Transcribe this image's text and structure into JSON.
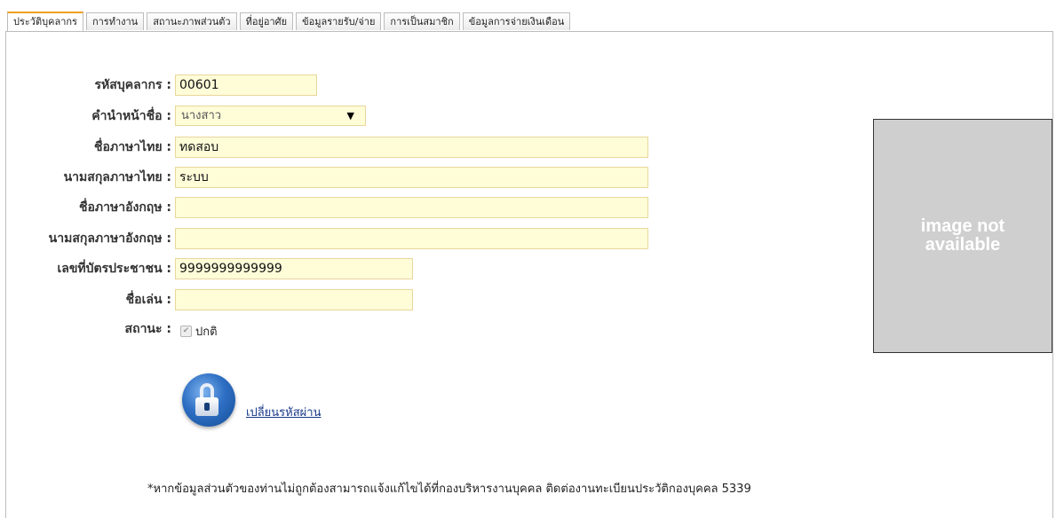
{
  "tabs": [
    {
      "label": "ประวัติบุคลากร",
      "active": true
    },
    {
      "label": "การทำงาน",
      "active": false
    },
    {
      "label": "สถานะภาพส่วนตัว",
      "active": false
    },
    {
      "label": "ที่อยู่อาศัย",
      "active": false
    },
    {
      "label": "ข้อมูลรายรับ/จ่าย",
      "active": false
    },
    {
      "label": "การเป็นสมาชิก",
      "active": false
    },
    {
      "label": "ข้อมูลการจ่ายเงินเดือน",
      "active": false
    }
  ],
  "form": {
    "employee_id": {
      "label": "รหัสบุคลากร :",
      "value": "00601"
    },
    "prefix": {
      "label": "คำนำหน้าชื่อ :",
      "value": "นางสาว"
    },
    "thai_first_name": {
      "label": "ชื่อภาษาไทย :",
      "value": "ทดสอบ"
    },
    "thai_last_name": {
      "label": "นามสกุลภาษาไทย :",
      "value": "ระบบ"
    },
    "eng_first_name": {
      "label": "ชื่อภาษาอังกฤษ :",
      "value": ""
    },
    "eng_last_name": {
      "label": "นามสกุลภาษาอังกฤษ :",
      "value": ""
    },
    "id_card": {
      "label": "เลขที่บัตรประชาชน :",
      "value": "9999999999999"
    },
    "nickname": {
      "label": "ชื่อเล่น :",
      "value": ""
    },
    "status": {
      "label": "สถานะ :",
      "value": "ปกติ",
      "checked": true
    }
  },
  "photo": {
    "placeholder": "image not\navailable"
  },
  "change_password": {
    "label": "เปลี่ยนรหัสผ่าน",
    "icon": "lock-icon"
  },
  "note": "*หากข้อมูลส่วนตัวของท่านไม่ถูกต้องสามารถแจ้งแก้ไขได้ที่กองบริหารงานบุคคล ติดต่องานทะเบียนประวัติกองบุคคล 5339",
  "colors": {
    "field_bg": "#fffcd8",
    "field_border": "#e8d79c",
    "active_tab_accent": "#f0a020",
    "link": "#1a3a8a"
  }
}
